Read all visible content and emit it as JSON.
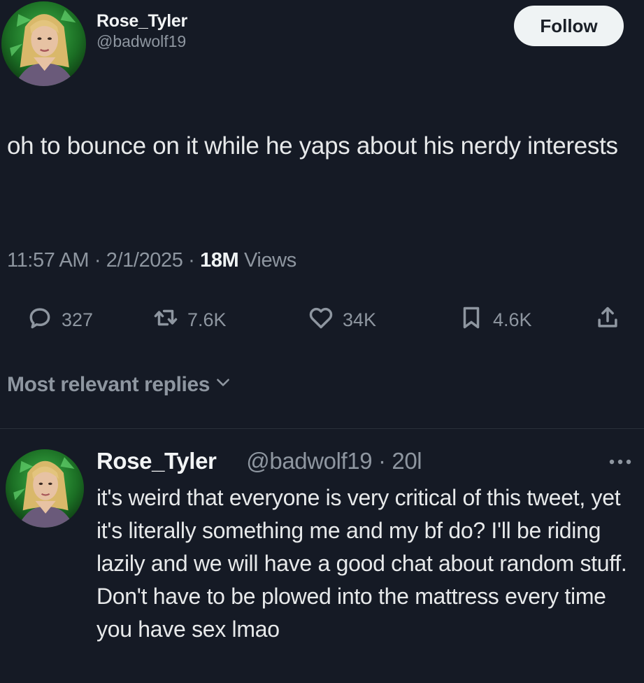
{
  "tweet": {
    "author_name": "Rose_Tyler",
    "author_handle": "@badwolf19",
    "follow_label": "Follow",
    "text": "oh to bounce on it while he yaps about his nerdy interests",
    "time": "11:57 AM",
    "date": "2/1/2025",
    "separator": "·",
    "views_count": "18M",
    "views_label": "Views"
  },
  "actions": {
    "replies": "327",
    "retweets": "7.6K",
    "likes": "34K",
    "bookmarks": "4.6K"
  },
  "icons": [
    "reply-icon",
    "retweet-icon",
    "heart-icon",
    "bookmark-icon",
    "share-icon",
    "chevron-down-icon",
    "more-icon"
  ],
  "replies_sort": {
    "label": "Most relevant replies"
  },
  "reply": {
    "author_name": "Rose_Tyler",
    "author_handle": "@badwolf19",
    "separator": "·",
    "time": "20l",
    "text": "it's weird that everyone is very critical of this tweet, yet it's literally something me and my bf do? I'll be riding lazily and we will have a good chat about random stuff. Don't have to be plowed into the mattress every time you have sex lmao"
  },
  "colors": {
    "background": "#151a25",
    "text": "#e7e9ea",
    "muted": "#8e96a0",
    "follow_bg": "#eff3f4"
  }
}
